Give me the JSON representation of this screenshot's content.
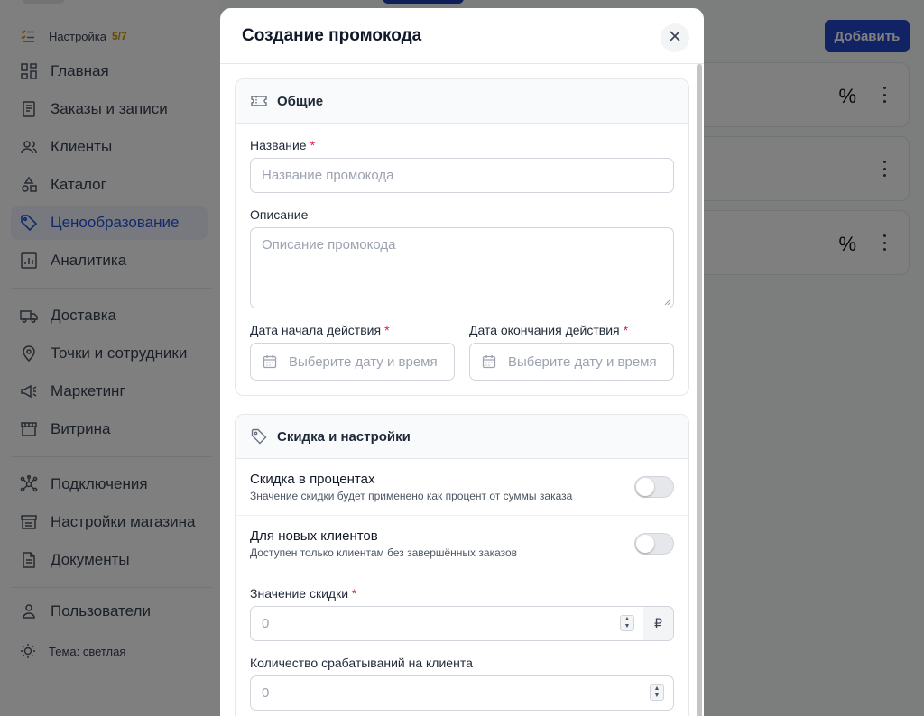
{
  "sidebar": {
    "setup": {
      "label": "Настройка",
      "badge": "5/7"
    },
    "items": [
      {
        "label": "Главная",
        "icon": "grid-icon"
      },
      {
        "label": "Заказы и записи",
        "icon": "receipt-icon"
      },
      {
        "label": "Клиенты",
        "icon": "users-icon"
      },
      {
        "label": "Каталог",
        "icon": "shapes-icon"
      },
      {
        "label": "Ценообразование",
        "icon": "tag-icon",
        "active": true
      },
      {
        "label": "Аналитика",
        "icon": "chart-icon"
      },
      {
        "label": "Доставка",
        "icon": "truck-icon"
      },
      {
        "label": "Точки и сотрудники",
        "icon": "map-pin-icon"
      },
      {
        "label": "Маркетинг",
        "icon": "megaphone-icon"
      },
      {
        "label": "Витрина",
        "icon": "store-icon"
      },
      {
        "label": "Подключения",
        "icon": "network-icon"
      },
      {
        "label": "Настройки магазина",
        "icon": "store-settings-icon"
      },
      {
        "label": "Документы",
        "icon": "document-icon"
      },
      {
        "label": "Пользователи",
        "icon": "user-icon"
      }
    ],
    "theme": "Тема: светлая"
  },
  "main": {
    "add_button": "Добавить",
    "card_symbol": "%"
  },
  "modal": {
    "title": "Создание промокода",
    "general": {
      "title": "Общие",
      "name_label": "Название",
      "name_placeholder": "Название промокода",
      "desc_label": "Описание",
      "desc_placeholder": "Описание промокода",
      "start_label": "Дата начала действия",
      "start_placeholder": "Выберите дату и время",
      "end_label": "Дата окончания действия",
      "end_placeholder": "Выберите дату и время"
    },
    "discount": {
      "title": "Скидка и настройки",
      "percent_title": "Скидка в процентах",
      "percent_desc": "Значение скидки будет применено как процент от суммы заказа",
      "percent_on": false,
      "new_title": "Для новых клиентов",
      "new_desc": "Доступен только клиентам без завершённых заказов",
      "new_on": false,
      "value_label": "Значение скидки",
      "value_placeholder": "0",
      "currency": "₽",
      "uses_label": "Количество срабатываний на клиента",
      "uses_placeholder": "0"
    }
  },
  "colors": {
    "accent": "#2454d6",
    "primary_button": "#2346c9",
    "required": "#e11d48",
    "badge": "#d29600"
  }
}
